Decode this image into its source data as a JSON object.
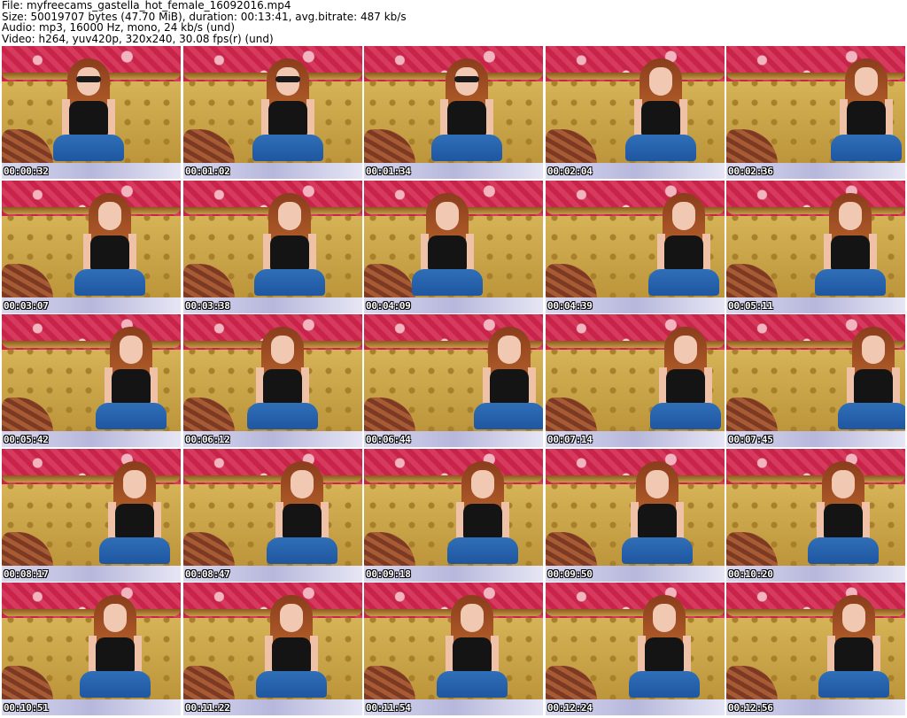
{
  "header": {
    "line1": "File: myfreecams_gastella_hot_female_16092016.mp4",
    "line2": "Size: 50019707 bytes (47.70 MiB), duration: 00:13:41, avg.bitrate: 487 kb/s",
    "line3": "Audio: mp3, 16000 Hz, mono, 24 kb/s (und)",
    "line4": "Video: h264, yuv420p, 320x240, 30.08 fps(r) (und)"
  },
  "timestamps": [
    "00:00:32",
    "00:01:02",
    "00:01:34",
    "00:02:04",
    "00:02:36",
    "00:03:07",
    "00:03:38",
    "00:04:09",
    "00:04:39",
    "00:05:11",
    "00:05:42",
    "00:06:12",
    "00:06:44",
    "00:07:14",
    "00:07:45",
    "00:08:17",
    "00:08:47",
    "00:09:18",
    "00:09:50",
    "00:10:20",
    "00:10:51",
    "00:11:22",
    "00:11:54",
    "00:12:24",
    "00:12:56"
  ],
  "colors": {
    "wallpaper": "#c8244a",
    "sofa": "#c9a24a",
    "top": "#141414",
    "jeans": "#2f6fb8"
  }
}
